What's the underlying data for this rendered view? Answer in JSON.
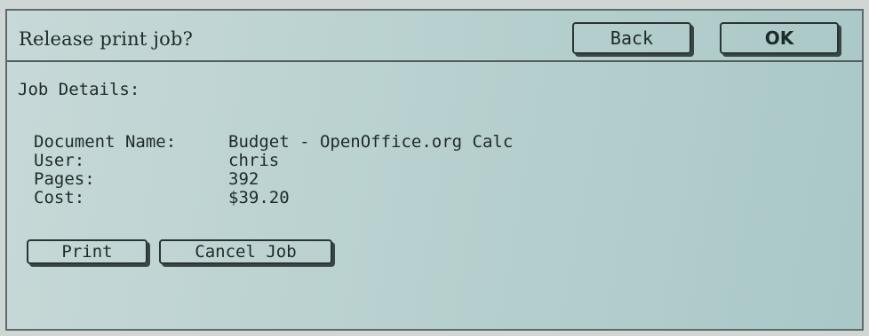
{
  "header": {
    "title": "Release print job?",
    "back_label": "Back",
    "ok_label": "OK"
  },
  "details": {
    "section_label": "Job Details:",
    "rows": [
      {
        "label": "Document Name:",
        "value": "Budget - OpenOffice.org Calc"
      },
      {
        "label": "User:",
        "value": "chris"
      },
      {
        "label": "Pages:",
        "value": "392"
      },
      {
        "label": "Cost:",
        "value": "$39.20"
      }
    ]
  },
  "actions": {
    "print_label": "Print",
    "cancel_label": "Cancel Job"
  }
}
